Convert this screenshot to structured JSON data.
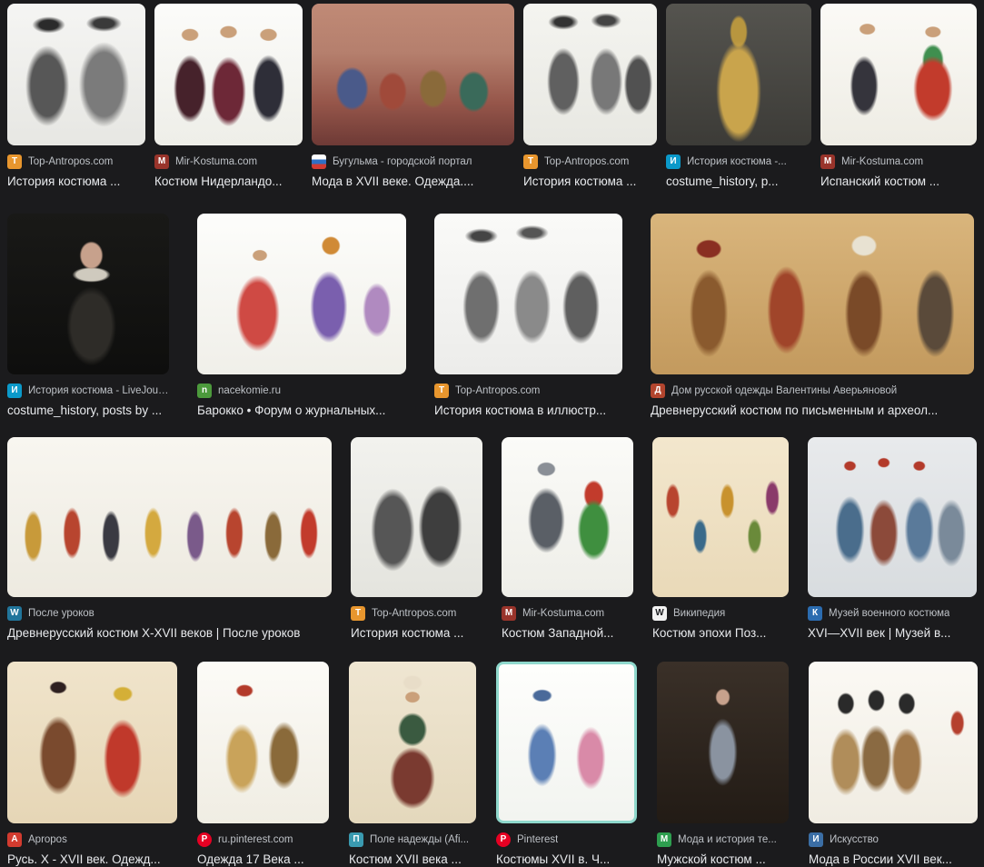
{
  "page": {
    "background": "#1b1b1d"
  },
  "rows": [
    {
      "items": [
        {
          "source": "Top-Antropos.com",
          "title": "История костюма ...",
          "favicon": {
            "name": "top-antropos-favicon",
            "glyph": "Т",
            "bg": "#e8962e",
            "fg": "#ffffff"
          }
        },
        {
          "source": "Mir-Kostuma.com",
          "title": "Костюм Нидерландо...",
          "favicon": {
            "name": "mir-kostuma-favicon",
            "glyph": "М",
            "bg": "#99342b",
            "fg": "#ffffff"
          }
        },
        {
          "source": "Бугульма - городской портал",
          "title": "Мода в XVII веке. Одежда....",
          "favicon": {
            "name": "bugulma-favicon",
            "glyph": "",
            "bg": "linear-gradient(180deg,#ffffff 0 34%,#2f6fc4 34% 67%,#d23b33 67% 100%)",
            "fg": "#ffffff"
          }
        },
        {
          "source": "Top-Antropos.com",
          "title": "История костюма ...",
          "favicon": {
            "name": "top-antropos-favicon",
            "glyph": "Т",
            "bg": "#e8962e",
            "fg": "#ffffff"
          }
        },
        {
          "source": "История костюма -...",
          "title": "costume_history, p...",
          "favicon": {
            "name": "livejournal-favicon",
            "glyph": "И",
            "bg": "#0b99c9",
            "fg": "#ffffff"
          }
        },
        {
          "source": "Mir-Kostuma.com",
          "title": "Испанский костюм ...",
          "favicon": {
            "name": "mir-kostuma-favicon",
            "glyph": "М",
            "bg": "#99342b",
            "fg": "#ffffff"
          }
        }
      ]
    },
    {
      "items": [
        {
          "source": "История костюма - LiveJour...",
          "title": "costume_history, posts by ...",
          "favicon": {
            "name": "livejournal-favicon",
            "glyph": "И",
            "bg": "#0b99c9",
            "fg": "#ffffff"
          }
        },
        {
          "source": "nacekomie.ru",
          "title": "Барокко • Форум о журнальных...",
          "favicon": {
            "name": "nacekomie-favicon",
            "glyph": "n",
            "bg": "#4c9a3c",
            "fg": "#ffffff"
          }
        },
        {
          "source": "Top-Antropos.com",
          "title": "История костюма в иллюстр...",
          "favicon": {
            "name": "top-antropos-favicon",
            "glyph": "Т",
            "bg": "#e8962e",
            "fg": "#ffffff"
          }
        },
        {
          "source": "Дом русской одежды Валентины Аверьяновой",
          "title": "Древнерусский костюм по письменным и археол...",
          "favicon": {
            "name": "dom-russkoy-odezhdy-favicon",
            "glyph": "Д",
            "bg": "#b3452e",
            "fg": "#ffffff"
          }
        }
      ]
    },
    {
      "items": [
        {
          "source": "После уроков",
          "title": "Древнерусский костюм X-XVII веков | После уроков",
          "favicon": {
            "name": "wordpress-favicon",
            "glyph": "W",
            "bg": "#21759b",
            "fg": "#ffffff"
          }
        },
        {
          "source": "Top-Antropos.com",
          "title": "История костюма ...",
          "favicon": {
            "name": "top-antropos-favicon",
            "glyph": "Т",
            "bg": "#e8962e",
            "fg": "#ffffff"
          }
        },
        {
          "source": "Mir-Kostuma.com",
          "title": "Костюм Западной...",
          "favicon": {
            "name": "mir-kostuma-favicon",
            "glyph": "М",
            "bg": "#99342b",
            "fg": "#ffffff"
          }
        },
        {
          "source": "Википедия",
          "title": "Костюм эпохи Поз...",
          "favicon": {
            "name": "wikipedia-favicon",
            "glyph": "W",
            "bg": "#f2f2f2",
            "fg": "#202124"
          }
        },
        {
          "source": "Музей военного костюма",
          "title": "XVI—XVII век | Музей в...",
          "favicon": {
            "name": "muzey-voennogo-kostyuma-favicon",
            "glyph": "К",
            "bg": "#2b6cb0",
            "fg": "#ffffff"
          }
        }
      ]
    },
    {
      "items": [
        {
          "source": "Apropos",
          "title": "Русь. X - XVII век. Одежд...",
          "favicon": {
            "name": "apropos-favicon",
            "glyph": "A",
            "bg": "#d23b2f",
            "fg": "#ffffff"
          }
        },
        {
          "source": "ru.pinterest.com",
          "title": "Одежда 17 Века ...",
          "favicon": {
            "name": "pinterest-favicon",
            "glyph": "P",
            "bg": "#e60023",
            "fg": "#ffffff"
          }
        },
        {
          "source": "Поле надежды (Afi...",
          "title": "Костюм XVII века ...",
          "favicon": {
            "name": "pole-nadezhdy-favicon",
            "glyph": "П",
            "bg": "#3a9ab0",
            "fg": "#ffffff"
          }
        },
        {
          "source": "Pinterest",
          "title": "Костюмы XVII в. Ч...",
          "favicon": {
            "name": "pinterest-favicon",
            "glyph": "P",
            "bg": "#e60023",
            "fg": "#ffffff"
          }
        },
        {
          "source": "Мода и история те...",
          "title": "Мужской костюм ...",
          "favicon": {
            "name": "moda-i-istoriya-favicon",
            "glyph": "М",
            "bg": "#2e9e4f",
            "fg": "#ffffff"
          }
        },
        {
          "source": "Искусство",
          "title": "Мода в России XVII век...",
          "favicon": {
            "name": "iskusstvo-favicon",
            "glyph": "И",
            "bg": "#3b6ea5",
            "fg": "#ffffff"
          }
        }
      ]
    }
  ]
}
